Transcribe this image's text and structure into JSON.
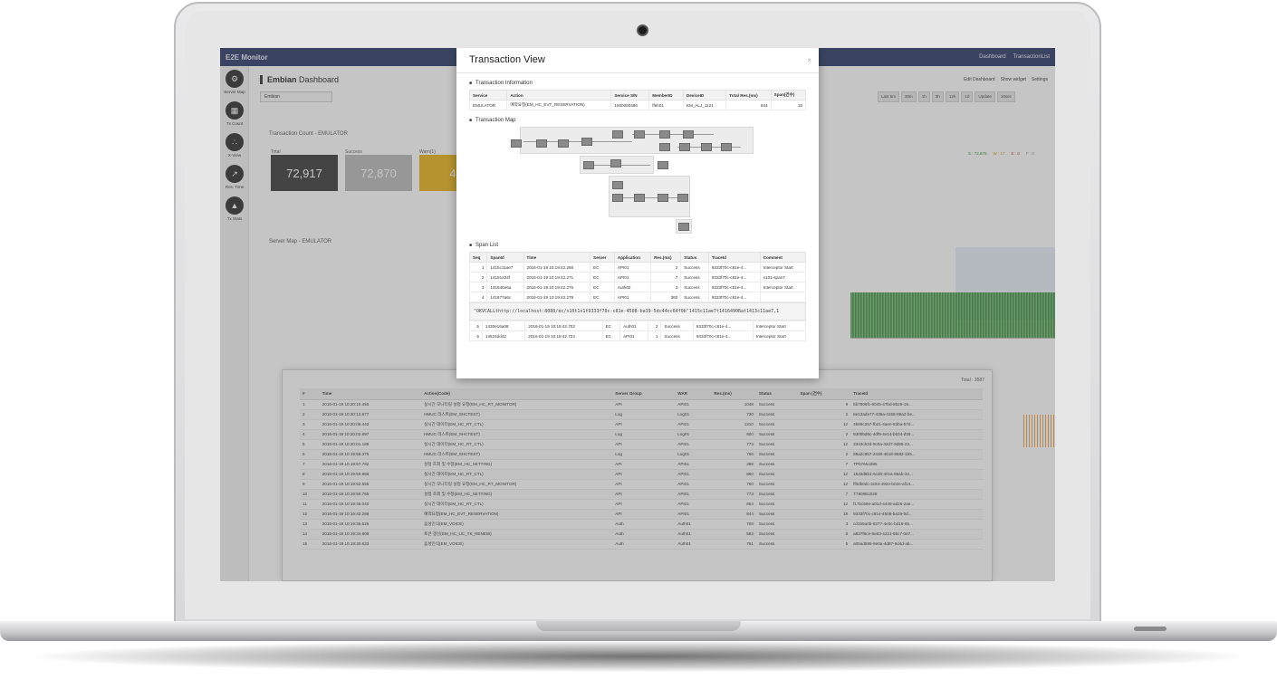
{
  "app": {
    "brand": "E2E Monitor",
    "nav_dashboard": "Dashboard",
    "nav_transaction_list": "TransactionList"
  },
  "sidebar": {
    "items": [
      {
        "label": "Server Map",
        "icon": "server-map-icon"
      },
      {
        "label": "Tx Count",
        "icon": "grid-icon"
      },
      {
        "label": "X-View",
        "icon": "scatter-icon"
      },
      {
        "label": "Res. Time",
        "icon": "line-chart-icon"
      },
      {
        "label": "Tx Stats",
        "icon": "area-chart-icon"
      }
    ]
  },
  "dashboard": {
    "title_bold": "Embian",
    "title_rest": " Dashboard",
    "select_value": "Embian",
    "tools": {
      "edit": "Edit Dashboard",
      "show_widget": "Show widget",
      "settings": "Settings"
    },
    "tx_count_label": "Transaction Count - EMULATOR",
    "server_map_label": "Server Map - EMULATOR",
    "kpis": [
      {
        "caption": "Total",
        "value": "72,917",
        "color": "#3a3a3a"
      },
      {
        "caption": "Success",
        "value": "72,870",
        "color": "#b8b8b8"
      },
      {
        "caption": "Warn(1)",
        "value": "4",
        "color": "#e9b21a"
      }
    ],
    "time_controls": [
      "Last 5m",
      "30m",
      "1h",
      "3h",
      "12h",
      "1d",
      "Update",
      "10sec"
    ],
    "legend": [
      "S : 72,870",
      "W : 17",
      "E : 0",
      "F : 0"
    ]
  },
  "transaction_list": {
    "total": "Total : 3587",
    "columns": [
      "#",
      "Time",
      "Action(Code)",
      "Server Group",
      "WAR",
      "Res.(ms)",
      "Status",
      "Span (건수)",
      "TraceId"
    ],
    "rows": [
      [
        "1",
        "2016-01-19 10:20:10.455",
        "실시간 모니터링 설정 요청(EM_HC_RT_MONITOR)",
        "API",
        "API01",
        "1048",
        "Success",
        "9",
        "5b7806fc-6045-47bd-8b29-19..."
      ],
      [
        "2",
        "2016-01-19 10:20:13.877",
        "HMUC 리스트(EM_SHCTEST)",
        "Log",
        "Log01",
        "730",
        "Success",
        "2",
        "8e13ade77-436a-4158-89a2-be..."
      ],
      [
        "3",
        "2016-01-19 10:20:06.443",
        "실시간 데이터(EM_HC_RT_CTL)",
        "API",
        "API01",
        "1310",
        "Success",
        "12",
        "4689c257-fb21-4aee-83ba-57d..."
      ],
      [
        "4",
        "2016-01-19 10:20:02.897",
        "HMUC 리스트(EM_SHCTEST)",
        "Log",
        "Log01",
        "800",
        "Success",
        "2",
        "6300bd6c-4df9-4e14-bb34-d29..."
      ],
      [
        "5",
        "2016-01-19 10:20:01.189",
        "실시간 데이터(EM_HC_RT_CTL)",
        "API",
        "API01",
        "773",
        "Success",
        "12",
        "2343cb2d-9c0a-42d7-9d85-23..."
      ],
      [
        "6",
        "2016-01-19 10:19:58.375",
        "HMUC 리스트(EM_SHCTEST)",
        "Log",
        "Log01",
        "796",
        "Success",
        "2",
        "59a2c857-2438-4618-8682-1b5..."
      ],
      [
        "7",
        "2016-01-19 10:19:57.782",
        "설정 조회 및 수정(EM_HC_SETTING)",
        "API",
        "API01",
        "398",
        "Success",
        "7",
        "TP07651085"
      ],
      [
        "8",
        "2016-01-19 10:19:50.966",
        "실시간 데이터(EM_HC_RT_CTL)",
        "API",
        "API01",
        "860",
        "Success",
        "12",
        "1533d8b1-6cd0-40ca-86ab-34..."
      ],
      [
        "9",
        "2016-01-19 10:19:52.555",
        "실시간 모니터링 설정 요청(EM_HC_RT_MONITOR)",
        "API",
        "API01",
        "760",
        "Success",
        "12",
        "ff0db0dc-3c84-492e-b02e-af14..."
      ],
      [
        "10",
        "2016-01-19 10:19:50.765",
        "설정 조회 및 수정(EM_HC_SETTING)",
        "API",
        "API01",
        "773",
        "Success",
        "7",
        "T7809B1028"
      ],
      [
        "11",
        "2016-01-19 10:19:46.040",
        "실시간 데이터(EM_HC_RT_CTL)",
        "API",
        "API01",
        "854",
        "Success",
        "12",
        "f17bc69e-a01d-4449-ad26-2ae..."
      ],
      [
        "12",
        "2016-01-19 10:19:42.288",
        "예약요청(EM_HC_EVT_RESERVATION)",
        "API",
        "API01",
        "844",
        "Success",
        "18",
        "9333f70c-c81e-4508-ba19-5d..."
      ],
      [
        "13",
        "2016-01-19 10:19:36.525",
        "음성인식(EM_VOICE)",
        "Auth",
        "Auth01",
        "708",
        "Success",
        "3",
        "cd155a0b-8377-4e0c-bd18-65..."
      ],
      [
        "14",
        "2016-01-19 10:19:34.809",
        "토큰 갱신(EM_HC_UC_TK_RENEW)",
        "Auth",
        "Auth01",
        "583",
        "Success",
        "8",
        "a827f6ce-8e83-4221-9bc7-0e7..."
      ],
      [
        "15",
        "2016-01-19 10:19:30.633",
        "음성인식(EM_VOICE)",
        "Auth",
        "Auth01",
        "761",
        "Success",
        "5",
        "a05ad586-8e0a-4d87-9d4d-ab..."
      ]
    ]
  },
  "modal": {
    "title": "Transaction View",
    "close": "×",
    "info_section": "Transaction Information",
    "info_columns": [
      "Service",
      "Action",
      "Service S/N",
      "MemberID",
      "DeviceID",
      "Total Res.(ms)",
      "Span(건수)"
    ],
    "info_row": [
      "EMULATOR",
      "예약요청(EM_HC_EVT_RESERVATION)",
      "1000000486",
      "ffeh01",
      "KM_ALJ_1121",
      "844",
      "18"
    ],
    "map_section": "Transaction Map",
    "span_section": "Span List",
    "span_columns": [
      "Seq",
      "SpanId",
      "Time",
      "Server",
      "Application",
      "Res.(ms)",
      "Status",
      "TraceId",
      "Comment"
    ],
    "span_rows": [
      [
        "1",
        "1415c11ae7",
        "2016-01-19 10:19:42.268",
        "EC",
        "API01",
        "2",
        "Success",
        "9333f70c-c81e-4...",
        "Interceptor Start"
      ],
      [
        "2",
        "14191224f",
        "2016-01-19 10:19:42.271",
        "EC",
        "API01",
        "7",
        "Success",
        "9333f70c-c81e-4...",
        "s101-span7"
      ],
      [
        "3",
        "141646e6a",
        "2016-01-19 10:19:42.276",
        "EC",
        "Auth02",
        "2",
        "Success",
        "9333f70c-c81e-4...",
        "Interceptor Start"
      ],
      [
        "4",
        "141677a6c",
        "2016-01-19 10:19:42.279",
        "EC",
        "API01",
        "360",
        "Success",
        "9333f70c-c81e-4...",
        ""
      ]
    ],
    "code_text": "\"OKVCALLthttp://localhost:8080/ec/s10t1s1t9333f70c-c81e-4508-ba19-5dc44cc64f0b\"1415c11ae7t1416490Bat1413c11ae7,1",
    "span_rows_after": [
      [
        "5",
        "1430e16a08",
        "2016-01-19 10:19:42.702",
        "EC",
        "Auth01",
        "2",
        "Success",
        "9333f70c-c81e-4...",
        "Interceptor Start"
      ],
      [
        "6",
        "14524dd42",
        "2016-01-19 10:19:42.724",
        "EC",
        "API01",
        "1",
        "Success",
        "9333f70c-c81e-4...",
        "Interceptor Start"
      ]
    ]
  }
}
